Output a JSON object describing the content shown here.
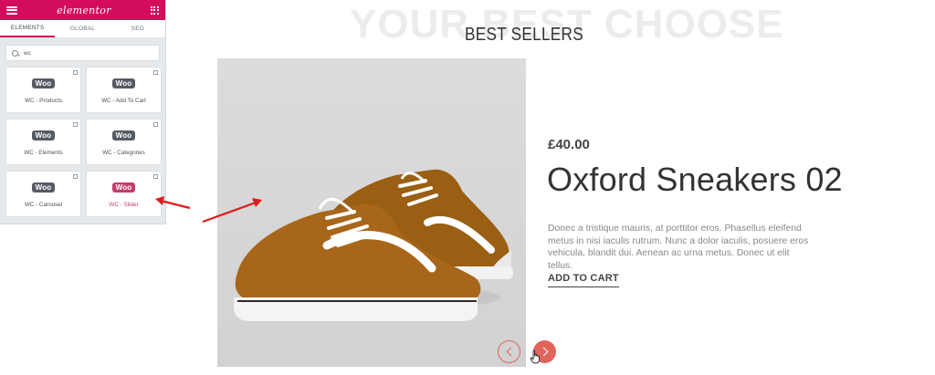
{
  "panel": {
    "header": {
      "logo": "elementor"
    },
    "tabs": [
      {
        "label": "ELEMENTS",
        "active": true
      },
      {
        "label": "GLOBAL",
        "active": false
      },
      {
        "label": "SEO",
        "active": false
      }
    ],
    "search": {
      "value": "wc"
    },
    "widgets": [
      {
        "badge": "Woo",
        "label": "WC - Products"
      },
      {
        "badge": "Woo",
        "label": "WC - Add To Cart"
      },
      {
        "badge": "Woo",
        "label": "WC - Elements"
      },
      {
        "badge": "Woo",
        "label": "WC - Categories"
      },
      {
        "badge": "Woo",
        "label": "WC - Carousel"
      },
      {
        "badge": "Woo",
        "label": "WC - Slider"
      }
    ],
    "accent_color": "#d30c5c"
  },
  "page": {
    "ghost_heading": "YOUR BEST CHOOSE",
    "section_title": "BEST SELLERS",
    "product": {
      "price": "£40.00",
      "title": "Oxford Sneakers 02",
      "description": "Donec a tristique mauris, at porttitor eros. Phasellus eleifend metus in nisi iaculis rutrum. Nunc a dolor iaculis, posuere eros vehicula, blandit dui. Aenean ac urna metus. Donec ut elit tellus.",
      "cta": "ADD TO CART"
    },
    "slider_nav": {
      "prev_icon": "chevron-left-icon",
      "next_icon": "chevron-right-icon"
    },
    "accent_color": "#e0645a"
  }
}
